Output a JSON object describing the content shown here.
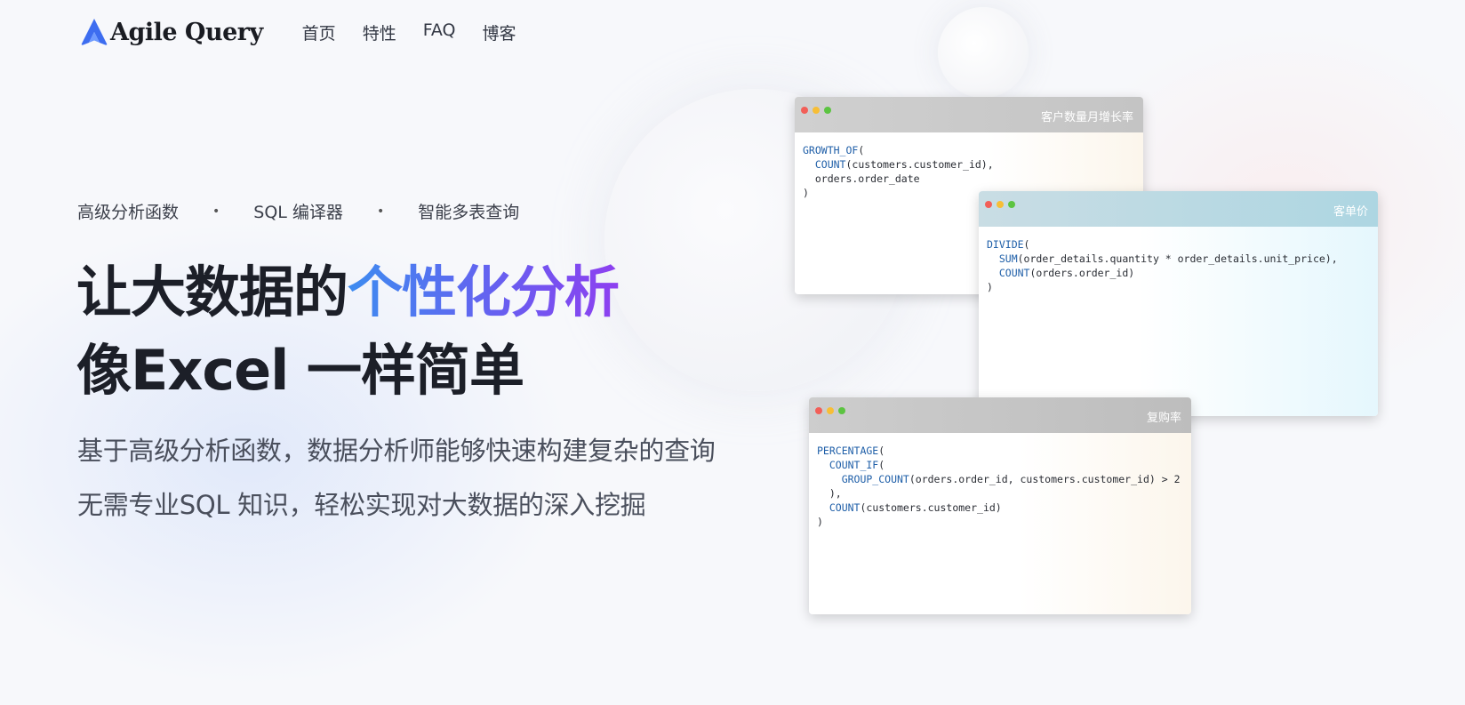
{
  "brand": {
    "name": "Agile Query",
    "color": "#3d6df0"
  },
  "nav": {
    "items": [
      "首页",
      "特性",
      "FAQ",
      "博客"
    ]
  },
  "features": [
    "高级分析函数",
    "SQL 编译器",
    "智能多表查询"
  ],
  "feature_separator": "•",
  "hero": {
    "line1_plain": "让大数据的",
    "line1_gradient": "个性化分析",
    "line2": "像Excel 一样简单",
    "sub1": "基于高级分析函数，数据分析师能够快速构建复杂的查询",
    "sub2": "无需专业SQL 知识，轻松实现对大数据的深入挖掘"
  },
  "cards": [
    {
      "title": "客户数量月增长率",
      "lines": [
        {
          "fn": "GROWTH_OF",
          "rest": "("
        },
        {
          "fn": "  COUNT",
          "rest": "(customers.customer_id),"
        },
        {
          "fn": "",
          "rest": "  orders.order_date"
        },
        {
          "fn": "",
          "rest": ")"
        }
      ]
    },
    {
      "title": "客单价",
      "lines": [
        {
          "fn": "DIVIDE",
          "rest": "("
        },
        {
          "fn": "  SUM",
          "rest": "(order_details.quantity * order_details.unit_price),"
        },
        {
          "fn": "  COUNT",
          "rest": "(orders.order_id)"
        },
        {
          "fn": "",
          "rest": ")"
        }
      ]
    },
    {
      "title": "复购率",
      "lines": [
        {
          "fn": "PERCENTAGE",
          "rest": "("
        },
        {
          "fn": "  COUNT_IF",
          "rest": "("
        },
        {
          "fn": "    GROUP_COUNT",
          "rest": "(orders.order_id, customers.customer_id) > 2"
        },
        {
          "fn": "",
          "rest": "  ),"
        },
        {
          "fn": "  COUNT",
          "rest": "(customers.customer_id)"
        },
        {
          "fn": "",
          "rest": ")"
        }
      ]
    }
  ]
}
